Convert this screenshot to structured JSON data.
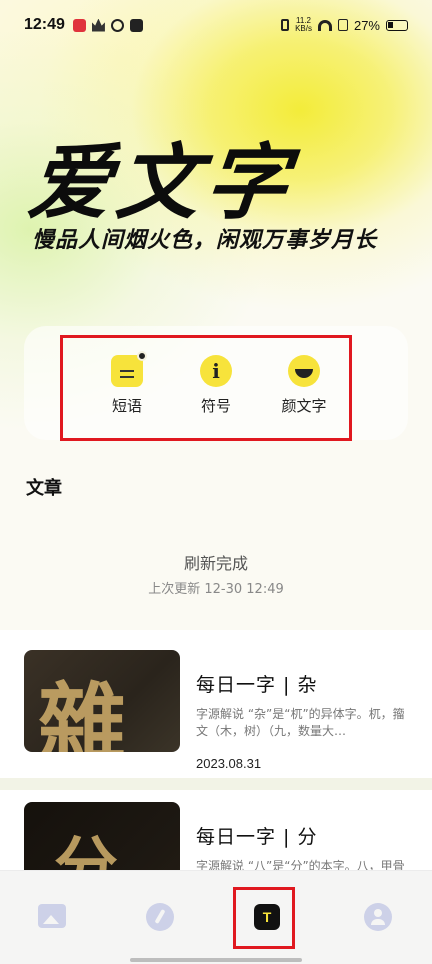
{
  "status_bar": {
    "time": "12:49",
    "net_speed_top": "11.2",
    "net_speed_bottom": "KB/s",
    "battery": "27%"
  },
  "hero": {
    "brand": "爱文字",
    "slogan": "慢品人间烟火色，闲观万事岁月长"
  },
  "quick_actions": [
    {
      "label": "短语",
      "icon": "phrase-icon"
    },
    {
      "label": "符号",
      "icon": "info-icon"
    },
    {
      "label": "颜文字",
      "icon": "emoticon-icon"
    }
  ],
  "section": {
    "title": "文章"
  },
  "refresh": {
    "status": "刷新完成",
    "last_update": "上次更新 12-30 12:49"
  },
  "articles": [
    {
      "title": "每日一字 | 杂",
      "glyph": "雜",
      "desc": "字源解说 “杂”是“杌”的异体字。杌，籀文（木，树）（九，数量大…",
      "date": "2023.08.31"
    },
    {
      "title": "每日一字 | 分",
      "glyph": "分",
      "desc": "字源解说 “八”是“分”的本字。八，甲骨文是指事字，字形由左右…"
    }
  ],
  "tabbar": {
    "items": [
      "picture-icon",
      "pen-icon",
      "text-icon",
      "user-icon"
    ],
    "active_glyph": "T"
  },
  "colors": {
    "accent": "#f7e33b",
    "highlight_annotation": "#e0181f"
  }
}
